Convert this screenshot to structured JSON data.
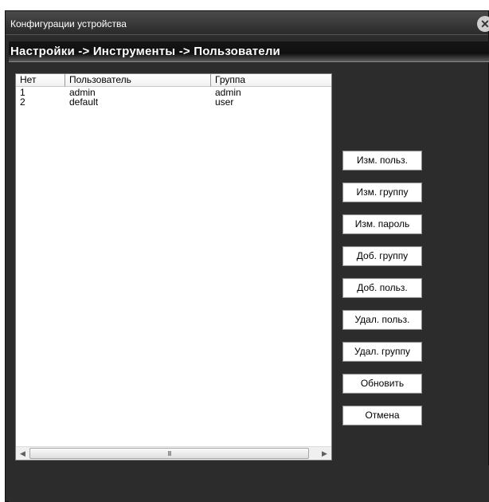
{
  "window": {
    "title": "Конфигурации устройства",
    "close_glyph": "✕"
  },
  "breadcrumb": "Настройки -> Инструменты -> Пользователи",
  "user_table": {
    "columns": [
      "Нет",
      "Пользователь",
      "Группа"
    ],
    "rows": [
      [
        "1",
        "admin",
        "admin"
      ],
      [
        "2",
        "default",
        "user"
      ]
    ]
  },
  "scrollbar": {
    "left_arrow": "◀",
    "right_arrow": "▶",
    "grip": "III"
  },
  "buttons": {
    "edit_user": "Изм. польз.",
    "edit_group": "Изм. группу",
    "edit_password": "Изм. пароль",
    "add_group": "Доб. группу",
    "add_user": "Доб. польз.",
    "delete_user": "Удал. польз.",
    "delete_group": "Удал. группу",
    "refresh": "Обновить",
    "cancel": "Отмена"
  }
}
